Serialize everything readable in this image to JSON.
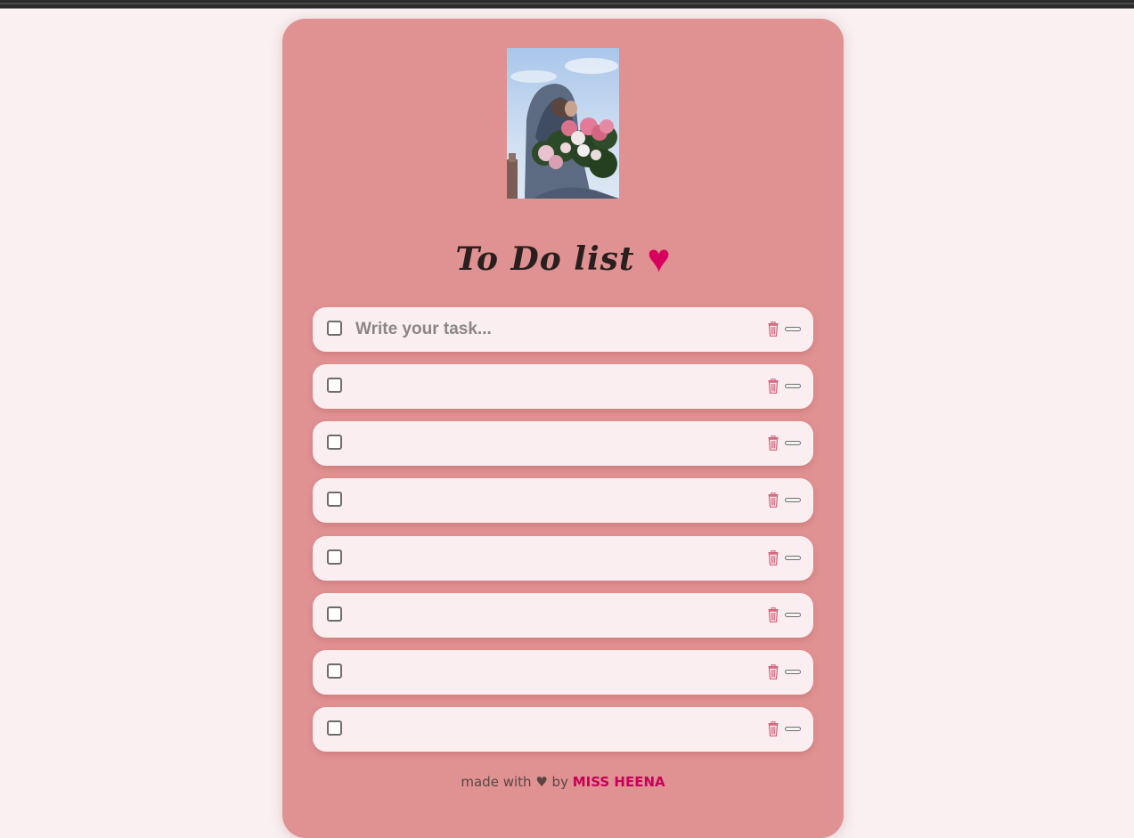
{
  "header": {
    "title": "To Do list",
    "heart_symbol": "♥"
  },
  "task_input": {
    "placeholder": "Write your task..."
  },
  "tasks": [
    {
      "value": ""
    },
    {
      "value": ""
    },
    {
      "value": ""
    },
    {
      "value": ""
    },
    {
      "value": ""
    },
    {
      "value": ""
    },
    {
      "value": ""
    },
    {
      "value": ""
    }
  ],
  "icons": {
    "row_delete": "trash-icon",
    "row_collapse": "minus-icon",
    "row_check": "checkbox"
  },
  "footer": {
    "prefix": "made with",
    "heart": "♥",
    "by": "by",
    "author": "MISS HEENA"
  },
  "colors": {
    "page_background": "#f9f0f1",
    "card_background": "#e09191",
    "row_background": "#fbeef0",
    "accent_heart": "#d8005f",
    "author": "#c8005a"
  }
}
